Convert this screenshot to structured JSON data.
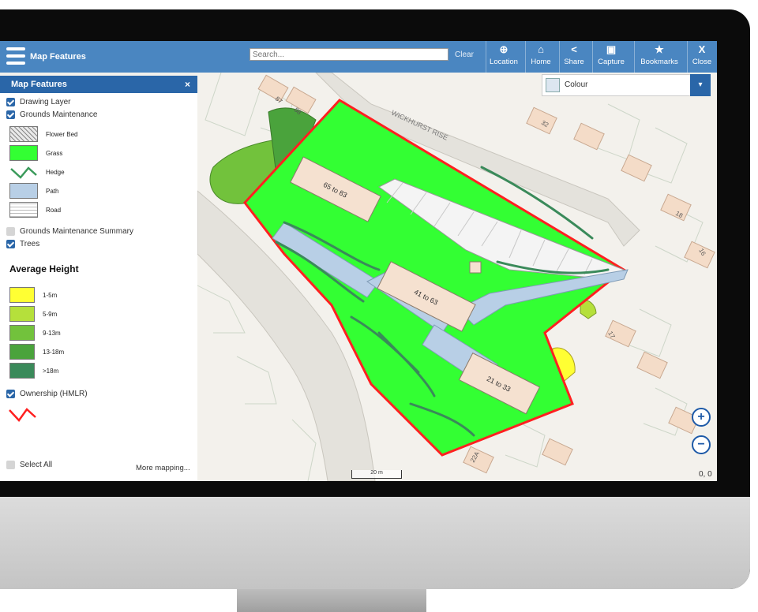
{
  "toolbar": {
    "title": "Map Features",
    "search_placeholder": "Search...",
    "clear_label": "Clear",
    "tools": [
      {
        "icon": "⊕",
        "label": "Location"
      },
      {
        "icon": "⌂",
        "label": "Home"
      },
      {
        "icon": "<",
        "label": "Share"
      },
      {
        "icon": "▣",
        "label": "Capture"
      },
      {
        "icon": "★",
        "label": "Bookmarks"
      },
      {
        "icon": "X",
        "label": "Close"
      }
    ]
  },
  "panel": {
    "title": "Map Features",
    "close_icon": "×",
    "layers": [
      {
        "label": "Drawing Layer",
        "checked": true
      },
      {
        "label": "Grounds Maintenance",
        "checked": true
      }
    ],
    "gm_legend": [
      {
        "label": "Flower Bed",
        "color": "#cfcfcf"
      },
      {
        "label": "Grass",
        "color": "#33ff33"
      },
      {
        "label": "Hedge",
        "color": "#3a9a5a"
      },
      {
        "label": "Path",
        "color": "#b8cfe6"
      },
      {
        "label": "Road",
        "color": "#ffffff"
      }
    ],
    "summary_label": "Grounds Maintenance Summary",
    "trees_label": "Trees",
    "avg_height_title": "Average Height",
    "height_legend": [
      {
        "label": "1-5m",
        "color": "#ffff33"
      },
      {
        "label": "5-9m",
        "color": "#b5e03b"
      },
      {
        "label": "9-13m",
        "color": "#72c23c"
      },
      {
        "label": "13-18m",
        "color": "#4aa33c"
      },
      {
        "label": ">18m",
        "color": "#3a8a5a"
      }
    ],
    "ownership_label": "Ownership (HMLR)",
    "ownership_color": "#ff2020",
    "select_all_label": "Select All",
    "more_mapping_label": "More mapping..."
  },
  "map": {
    "colour_select_label": "Colour",
    "road_label": "WICKHURST RISE",
    "buildings": [
      "65 to 83",
      "41 to 63",
      "21 to 33"
    ],
    "house_numbers": [
      "87",
      "88",
      "32",
      "18",
      "16",
      "17",
      "22A"
    ],
    "scale_label": "20 m",
    "coords": "0, 0",
    "zoom_in_icon": "+",
    "zoom_out_icon": "−"
  }
}
